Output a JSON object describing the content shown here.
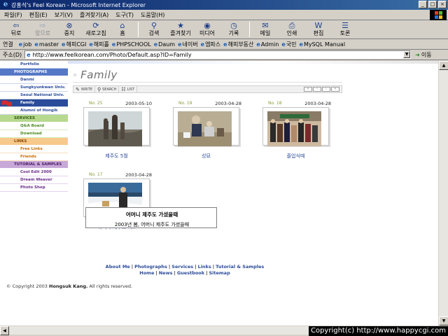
{
  "window": {
    "title": "강홍석's Feel Korean - Microsoft Internet Explorer",
    "minimize": "_",
    "maximize": "□",
    "close": "×"
  },
  "menu": [
    "파일(F)",
    "편집(E)",
    "보기(V)",
    "즐겨찾기(A)",
    "도구(T)",
    "도움말(H)"
  ],
  "toolbar": [
    {
      "label": "뒤로",
      "icon": "back-arrow-icon",
      "glyph": "⇦",
      "enabled": true
    },
    {
      "label": "앞으로",
      "icon": "forward-arrow-icon",
      "glyph": "⇨",
      "enabled": false
    },
    {
      "label": "중지",
      "icon": "stop-icon",
      "glyph": "⊗",
      "enabled": true
    },
    {
      "label": "새로고침",
      "icon": "refresh-icon",
      "glyph": "⟳",
      "enabled": true
    },
    {
      "label": "홈",
      "icon": "home-icon",
      "glyph": "⌂",
      "enabled": true
    },
    {
      "label": "검색",
      "icon": "search-icon",
      "glyph": "⚲",
      "enabled": true
    },
    {
      "label": "즐겨찾기",
      "icon": "favorites-icon",
      "glyph": "★",
      "enabled": true
    },
    {
      "label": "미디어",
      "icon": "media-icon",
      "glyph": "◉",
      "enabled": true
    },
    {
      "label": "기록",
      "icon": "history-icon",
      "glyph": "◷",
      "enabled": true
    },
    {
      "label": "메일",
      "icon": "mail-icon",
      "glyph": "✉",
      "enabled": true
    },
    {
      "label": "인쇄",
      "icon": "print-icon",
      "glyph": "⎙",
      "enabled": true
    },
    {
      "label": "편집",
      "icon": "edit-icon",
      "glyph": "W",
      "enabled": true
    },
    {
      "label": "토론",
      "icon": "discuss-icon",
      "glyph": "☰",
      "enabled": true
    }
  ],
  "links": {
    "label": "연결",
    "items": [
      "job",
      "master",
      "해피CGI",
      "해피홀",
      "PHPSCHOOL",
      "Daum",
      "네이버",
      "엠파스",
      "해피부동산",
      "Admin",
      "국민",
      "MySQL Manual"
    ]
  },
  "address": {
    "label": "주소(D)",
    "url": "http://www.feelkorean.com/Photo/Default.asp?ID=Family",
    "go_label": "이동"
  },
  "sidebar": {
    "items": [
      {
        "label": "Portfolio",
        "kind": "item",
        "tone": "blue"
      },
      {
        "label": "PHOTOGRAPHS",
        "kind": "cat",
        "tone": "blue"
      },
      {
        "label": "Danmi",
        "kind": "item",
        "tone": "blue"
      },
      {
        "label": "Sungkyunkwan Univ.",
        "kind": "item",
        "tone": "blue"
      },
      {
        "label": "Seoul National Univ.",
        "kind": "item",
        "tone": "blue"
      },
      {
        "label": "Family",
        "kind": "item",
        "tone": "blue",
        "active": true
      },
      {
        "label": "Alumni of Hongik",
        "kind": "item",
        "tone": "blue"
      },
      {
        "label": "SERVICES",
        "kind": "cat",
        "tone": "green"
      },
      {
        "label": "Q&A Board",
        "kind": "item",
        "tone": "green"
      },
      {
        "label": "Download",
        "kind": "item",
        "tone": "green"
      },
      {
        "label": "LINKS",
        "kind": "cat",
        "tone": "orange"
      },
      {
        "label": "Free Links",
        "kind": "item",
        "tone": "orange"
      },
      {
        "label": "Friends",
        "kind": "item",
        "tone": "orange"
      },
      {
        "label": "TUTORIAL & SAMPLES",
        "kind": "cat",
        "tone": "purple"
      },
      {
        "label": "Cool Edit 2000",
        "kind": "item",
        "tone": "purple"
      },
      {
        "label": "Dream Weaver",
        "kind": "item",
        "tone": "purple"
      },
      {
        "label": "Photo Shop",
        "kind": "item",
        "tone": "purple"
      }
    ]
  },
  "page": {
    "title": "Family",
    "board": {
      "write": "WRITE",
      "search": "SEARCH",
      "list": "LIST"
    }
  },
  "photos": [
    {
      "no": "No. 25",
      "date": "2003-05-10",
      "caption": "제주도 5월",
      "scene": "rocks-statues"
    },
    {
      "no": "No. 19",
      "date": "2003-04-28",
      "caption": "성묘",
      "scene": "people-hillside"
    },
    {
      "no": "No. 18",
      "date": "2003-04-28",
      "caption": "졸업식때",
      "scene": "graduation-group"
    },
    {
      "no": "No. 17",
      "date": "2003-04-28",
      "caption": "어머니 제주도 가..",
      "scene": "woman-snow-coast"
    }
  ],
  "tooltip": {
    "title": "어머니 제주도 가셨을때",
    "body": "2003년 봄, 어머니 제주도 가셨을때"
  },
  "footer": {
    "links_row1": [
      "About Me",
      "Photographs",
      "Services",
      "Links",
      "Tutorial & Samples"
    ],
    "links_row2": [
      "Home",
      "News",
      "Guestbook",
      "Sitemap"
    ],
    "copyright_prefix": "© Copyright 2003",
    "copyright_name": "Hongsuk Kang.",
    "copyright_suffix": "All rights reserved."
  },
  "watermark": "Copyright(c) http://www.happycgi.com"
}
